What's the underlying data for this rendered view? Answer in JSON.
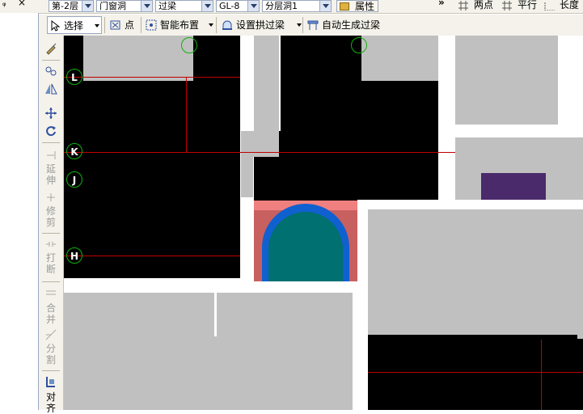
{
  "toolbar1": {
    "floor": "第-2层",
    "category": "门窗洞",
    "element": "过梁",
    "code": "GL-8",
    "layer": "分层洞1",
    "props_label": "属性",
    "two_point_label": "两点",
    "parallel_label": "平行",
    "length_label": "长度",
    "pin_symbol": "ᵩ",
    "close_symbol": "×",
    "overflow_symbol": "»"
  },
  "toolbar2": {
    "select_label": "选择",
    "point_label": "点",
    "smart_layout_label": "智能布置",
    "set_arch_label": "设置拱过梁",
    "auto_gen_label": "自动生成过梁"
  },
  "leftbar": {
    "extend_label": "延伸",
    "trim_label": "修剪",
    "break_label": "打断",
    "merge_label": "合并",
    "split_label": "分割",
    "align_label": "对齐"
  },
  "grid_labels": {
    "L": "L",
    "K": "K",
    "J": "J",
    "H": "H"
  },
  "colors": {
    "wall": "#c0c0c0",
    "opening_fill": "#007070",
    "arch_blue": "#1060d0",
    "lintel_pink": "#f08080",
    "purple_block": "#4a2a6a",
    "grid_circle": "#10b010",
    "axis_line": "#c00000"
  }
}
